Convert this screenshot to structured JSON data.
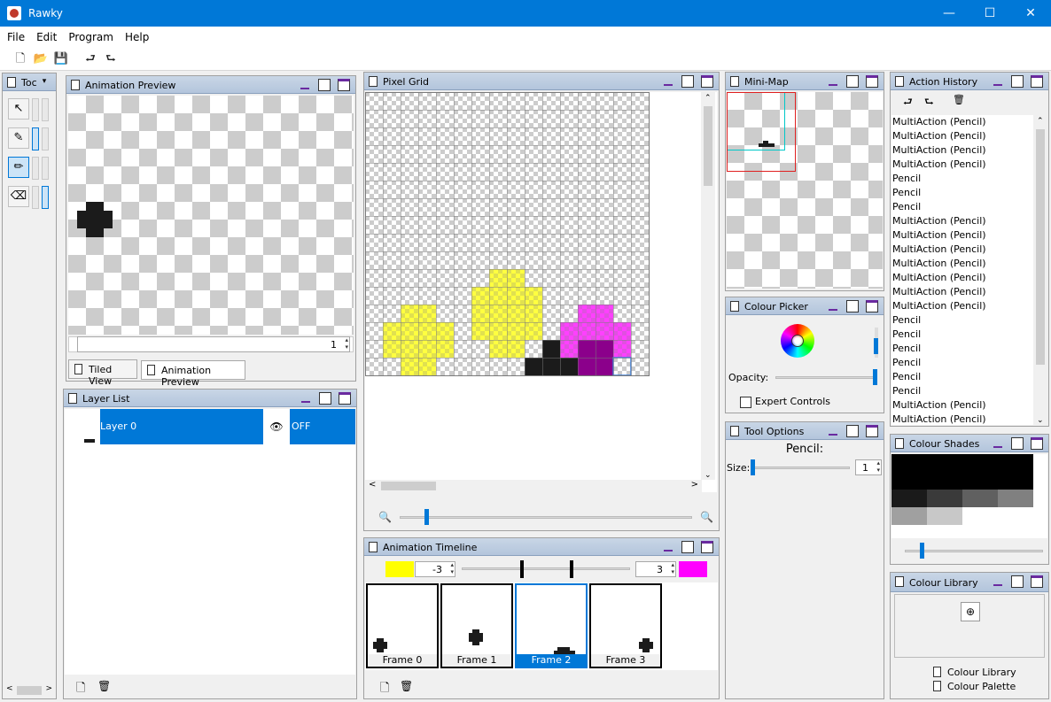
{
  "window": {
    "title": "Rawky",
    "minimize": "—",
    "maximize": "☐",
    "close": "✕"
  },
  "menu": [
    "File",
    "Edit",
    "Program",
    "Help"
  ],
  "toolbar": {
    "new": "🗋",
    "open": "📂",
    "save": "💾",
    "undo": "⮐",
    "redo": "⮑"
  },
  "tools_panel": {
    "title": "Toc",
    "tools": [
      "select-icon",
      "eyedropper-icon",
      "pencil-icon",
      "eraser-icon"
    ],
    "selected": 2
  },
  "animation_preview": {
    "title": "Animation Preview",
    "frame_value": "1",
    "tabs": [
      "Tiled View",
      "Animation Preview"
    ],
    "active_tab": 1
  },
  "layer_list": {
    "title": "Layer List",
    "layers": [
      {
        "name": "Layer 0",
        "visible_icon": "👁",
        "toggle": "OFF"
      }
    ]
  },
  "pixel_grid": {
    "title": "Pixel Grid",
    "zoom_min_icon": "zoom-out-icon",
    "zoom_max_icon": "zoom-in-icon"
  },
  "animation_timeline": {
    "title": "Animation Timeline",
    "left_color": "#ffff00",
    "left_value": "-3",
    "right_color": "#ff00ff",
    "right_value": "3",
    "frames": [
      "Frame 0",
      "Frame 1",
      "Frame 2",
      "Frame 3"
    ],
    "selected_frame": 2
  },
  "mini_map": {
    "title": "Mini-Map"
  },
  "colour_picker": {
    "title": "Colour Picker",
    "opacity_label": "Opacity:",
    "expert_label": "Expert Controls"
  },
  "tool_options": {
    "title": "Tool Options",
    "tool_name": "Pencil:",
    "size_label": "Size:",
    "size_value": "1"
  },
  "action_history": {
    "title": "Action History",
    "items": [
      "MultiAction (Pencil)",
      "MultiAction (Pencil)",
      "MultiAction (Pencil)",
      "MultiAction (Pencil)",
      "Pencil",
      "Pencil",
      "Pencil",
      "MultiAction (Pencil)",
      "MultiAction (Pencil)",
      "MultiAction (Pencil)",
      "MultiAction (Pencil)",
      "MultiAction (Pencil)",
      "MultiAction (Pencil)",
      "MultiAction (Pencil)",
      "Pencil",
      "Pencil",
      "Pencil",
      "Pencil",
      "Pencil",
      "Pencil",
      "MultiAction (Pencil)",
      "MultiAction (Pencil)"
    ]
  },
  "colour_shades": {
    "title": "Colour Shades",
    "shades": [
      "#000000",
      "#1a1a1a",
      "#3a3a3a",
      "#606060",
      "#808080",
      "#a0a0a0",
      "#c8c8c8"
    ]
  },
  "colour_library": {
    "title": "Colour Library",
    "tabs": [
      "Colour Library",
      "Colour Palette"
    ]
  }
}
